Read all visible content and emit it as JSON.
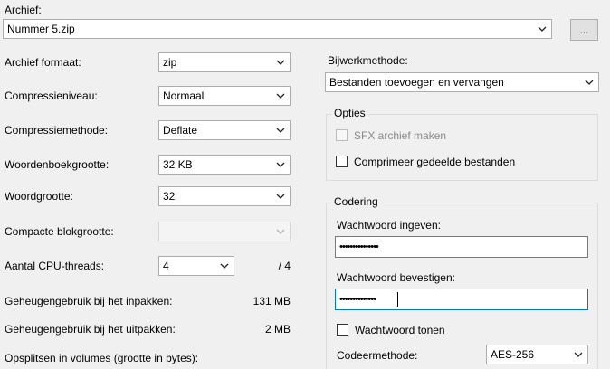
{
  "archive": {
    "label": "Archief:",
    "path": "Nummer 5.zip",
    "browse_label": "..."
  },
  "left": {
    "format": {
      "label": "Archief formaat:",
      "value": "zip"
    },
    "level": {
      "label": "Compressieniveau:",
      "value": "Normaal"
    },
    "method": {
      "label": "Compressiemethode:",
      "value": "Deflate"
    },
    "dict": {
      "label": "Woordenboekgrootte:",
      "value": "32 KB"
    },
    "word": {
      "label": "Woordgrootte:",
      "value": "32"
    },
    "solid": {
      "label": "Compacte blokgrootte:",
      "value": ""
    },
    "threads": {
      "label": "Aantal CPU-threads:",
      "value": "4",
      "max": "/ 4"
    },
    "mem_pack": {
      "label": "Geheugengebruik bij het inpakken:",
      "value": "131 MB"
    },
    "mem_unpack": {
      "label": "Geheugengebruik bij het uitpakken:",
      "value": "2 MB"
    },
    "split": {
      "label": "Opsplitsen in volumes (grootte in bytes):"
    }
  },
  "right": {
    "update": {
      "label": "Bijwerkmethode:",
      "value": "Bestanden toevoegen en vervangen"
    },
    "options": {
      "title": "Opties",
      "sfx_label": "SFX archief maken",
      "shared_label": "Comprimeer gedeelde bestanden"
    },
    "encryption": {
      "title": "Codering",
      "enter_label": "Wachtwoord ingeven:",
      "enter_value": "•••••••••••••••",
      "confirm_label": "Wachtwoord bevestigen:",
      "confirm_value": "••••••••••••••",
      "show_label": "Wachtwoord tonen",
      "method_label": "Codeermethode:",
      "method_value": "AES-256"
    }
  }
}
